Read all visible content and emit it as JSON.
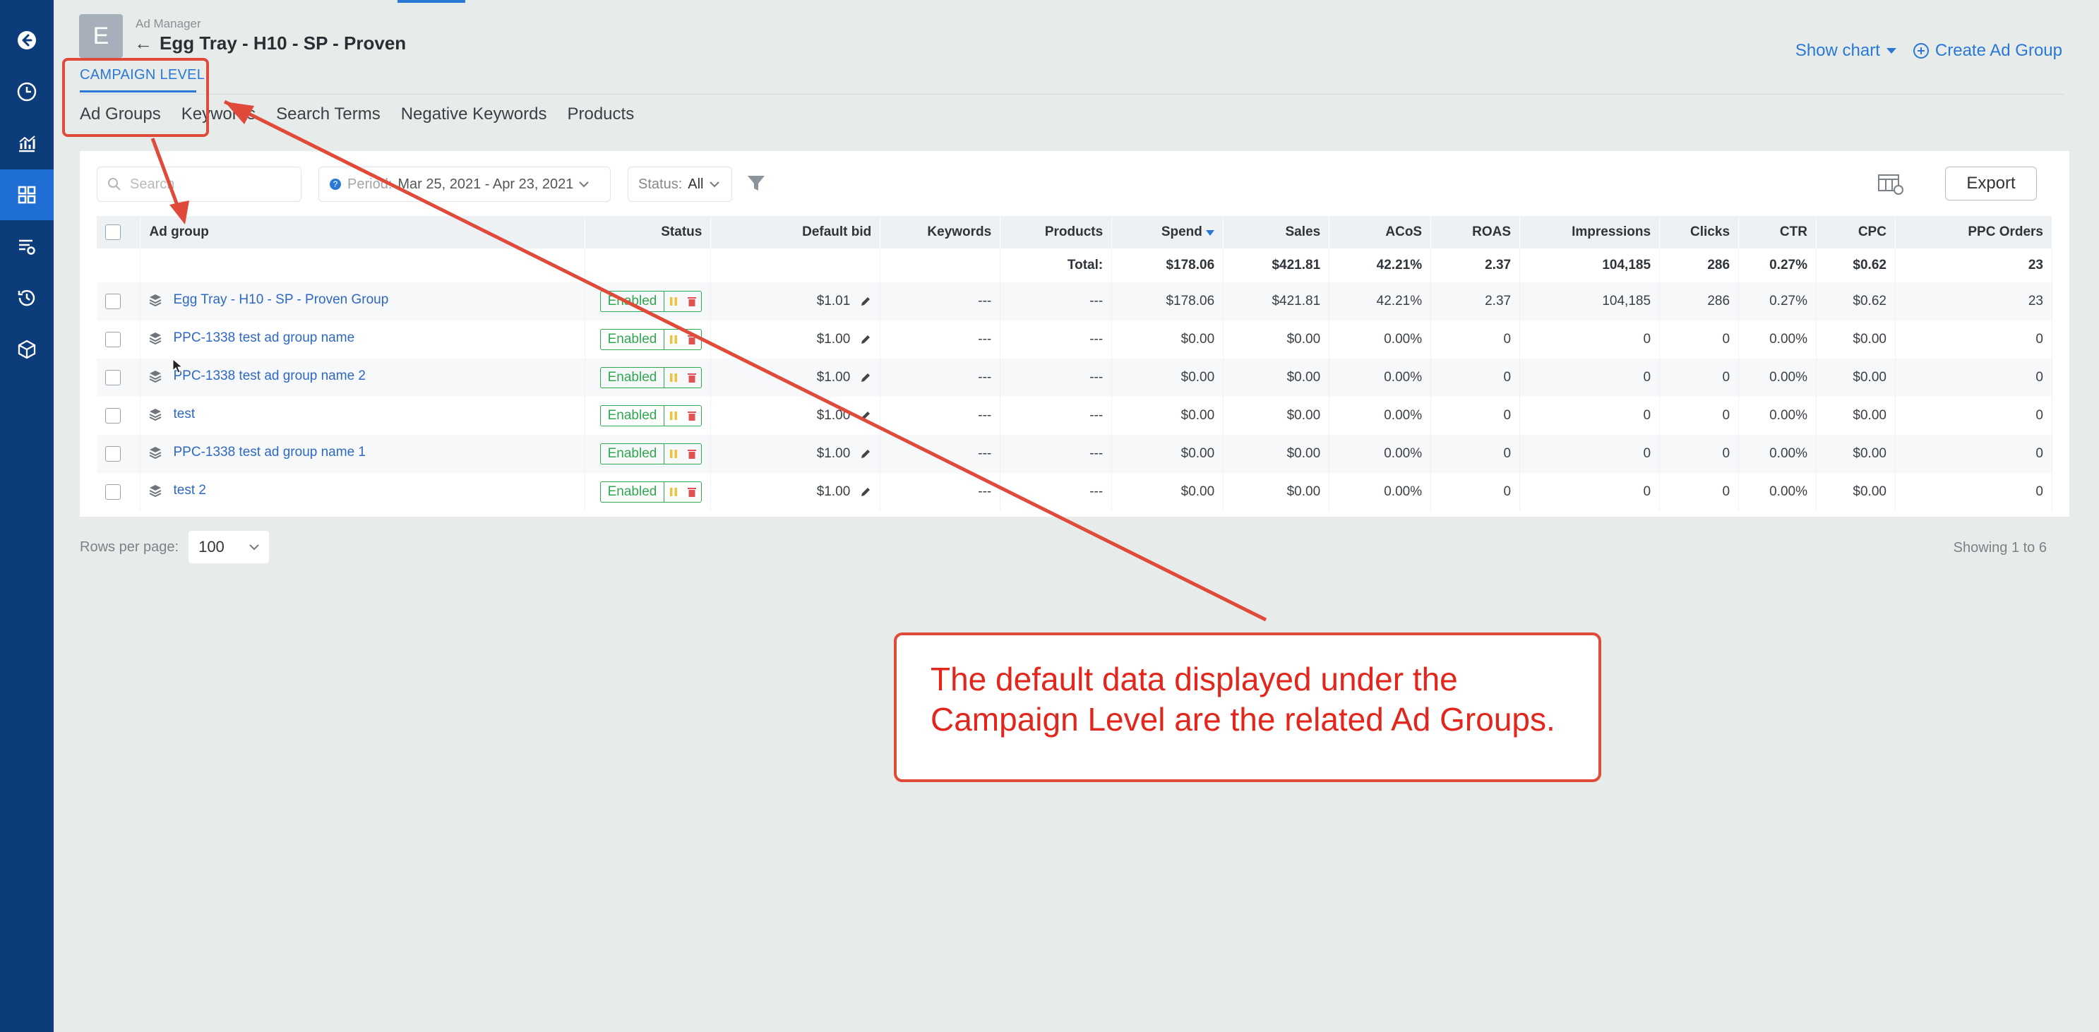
{
  "app": {
    "breadcrumb": "Ad Manager",
    "avatar_letter": "E",
    "campaign_title": "Egg Tray - H10 - SP - Proven",
    "back_arrow": "←",
    "show_chart": "Show chart",
    "create_ad_group": "Create Ad Group",
    "campaign_level": "CAMPAIGN LEVEL"
  },
  "sidebar": {
    "items": [
      {
        "icon": "back-circle-icon"
      },
      {
        "icon": "clock-icon"
      },
      {
        "icon": "analytics-icon"
      },
      {
        "icon": "grid-icon",
        "active": true
      },
      {
        "icon": "list-settings-icon"
      },
      {
        "icon": "history-icon"
      },
      {
        "icon": "box-icon"
      }
    ]
  },
  "subtabs": [
    "Ad Groups",
    "Keywords",
    "Search Terms",
    "Negative Keywords",
    "Products"
  ],
  "toolbar": {
    "search_placeholder": "Search",
    "period_label": "Period:",
    "period_value": "Mar 25, 2021 - Apr 23, 2021",
    "status_label": "Status:",
    "status_value": "All",
    "export_label": "Export"
  },
  "table": {
    "columns": [
      "Ad group",
      "Status",
      "Default bid",
      "Keywords",
      "Products",
      "Spend",
      "Sales",
      "ACoS",
      "ROAS",
      "Impressions",
      "Clicks",
      "CTR",
      "CPC",
      "PPC Orders"
    ],
    "total": {
      "label": "Total:",
      "spend": "$178.06",
      "sales": "$421.81",
      "acos": "42.21%",
      "roas": "2.37",
      "impressions": "104,185",
      "clicks": "286",
      "ctr": "0.27%",
      "cpc": "$0.62",
      "orders": "23"
    },
    "rows": [
      {
        "name": "Egg Tray - H10 - SP - Proven Group",
        "status": "Enabled",
        "bid": "$1.01",
        "keywords": "---",
        "products": "---",
        "spend": "$178.06",
        "sales": "$421.81",
        "acos": "42.21%",
        "roas": "2.37",
        "impressions": "104,185",
        "clicks": "286",
        "ctr": "0.27%",
        "cpc": "$0.62",
        "orders": "23"
      },
      {
        "name": "PPC-1338 test ad group name",
        "status": "Enabled",
        "bid": "$1.00",
        "keywords": "---",
        "products": "---",
        "spend": "$0.00",
        "sales": "$0.00",
        "acos": "0.00%",
        "roas": "0",
        "impressions": "0",
        "clicks": "0",
        "ctr": "0.00%",
        "cpc": "$0.00",
        "orders": "0"
      },
      {
        "name": "PPC-1338 test ad group name 2",
        "status": "Enabled",
        "bid": "$1.00",
        "keywords": "---",
        "products": "---",
        "spend": "$0.00",
        "sales": "$0.00",
        "acos": "0.00%",
        "roas": "0",
        "impressions": "0",
        "clicks": "0",
        "ctr": "0.00%",
        "cpc": "$0.00",
        "orders": "0"
      },
      {
        "name": "test",
        "status": "Enabled",
        "bid": "$1.00",
        "keywords": "---",
        "products": "---",
        "spend": "$0.00",
        "sales": "$0.00",
        "acos": "0.00%",
        "roas": "0",
        "impressions": "0",
        "clicks": "0",
        "ctr": "0.00%",
        "cpc": "$0.00",
        "orders": "0"
      },
      {
        "name": "PPC-1338 test ad group name 1",
        "status": "Enabled",
        "bid": "$1.00",
        "keywords": "---",
        "products": "---",
        "spend": "$0.00",
        "sales": "$0.00",
        "acos": "0.00%",
        "roas": "0",
        "impressions": "0",
        "clicks": "0",
        "ctr": "0.00%",
        "cpc": "$0.00",
        "orders": "0"
      },
      {
        "name": "test 2",
        "status": "Enabled",
        "bid": "$1.00",
        "keywords": "---",
        "products": "---",
        "spend": "$0.00",
        "sales": "$0.00",
        "acos": "0.00%",
        "roas": "0",
        "impressions": "0",
        "clicks": "0",
        "ctr": "0.00%",
        "cpc": "$0.00",
        "orders": "0"
      }
    ]
  },
  "footer": {
    "rows_per_page_label": "Rows per page:",
    "rows_per_page_value": "100",
    "showing": "Showing 1 to 6"
  },
  "annotation": {
    "callout_line1": "The default data displayed under the",
    "callout_line2": "Campaign Level are the related Ad Groups.",
    "color": "#e04a3a"
  },
  "colors": {
    "sidebar": "#0c3c7a",
    "accent": "#2a78d6",
    "enabled": "#2fa84f",
    "acos_highlight": "#d9a01a"
  }
}
